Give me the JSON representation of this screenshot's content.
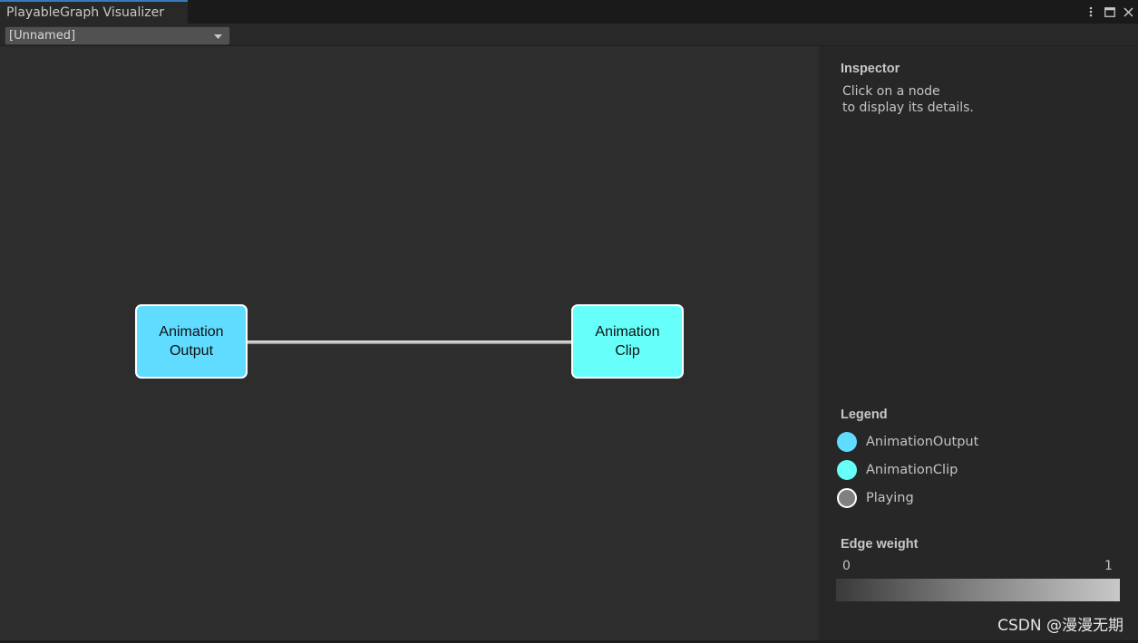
{
  "window": {
    "tab_title": "PlayableGraph Visualizer",
    "icons": [
      "more-icon",
      "maximize-icon",
      "close-icon"
    ]
  },
  "toolbar": {
    "graph_selector_value": "[Unnamed]"
  },
  "graph": {
    "nodes": [
      {
        "type": "AnimationOutput",
        "line1": "Animation",
        "line2": "Output",
        "color": "#5fdcff"
      },
      {
        "type": "AnimationClip",
        "line1": "Animation",
        "line2": "Clip",
        "color": "#66fffa"
      }
    ],
    "edge_color": "#c4c4c4"
  },
  "inspector": {
    "title": "Inspector",
    "hint_line1": "Click on a node",
    "hint_line2": "to display its details."
  },
  "legend": {
    "title": "Legend",
    "items": [
      {
        "label": "AnimationOutput",
        "color": "#5fdcff"
      },
      {
        "label": "AnimationClip",
        "color": "#66fffa"
      },
      {
        "label": "Playing",
        "color": "#808080"
      }
    ]
  },
  "edge_weight": {
    "title": "Edge weight",
    "min_label": "0",
    "max_label": "1"
  },
  "watermark": "CSDN @漫漫无期"
}
